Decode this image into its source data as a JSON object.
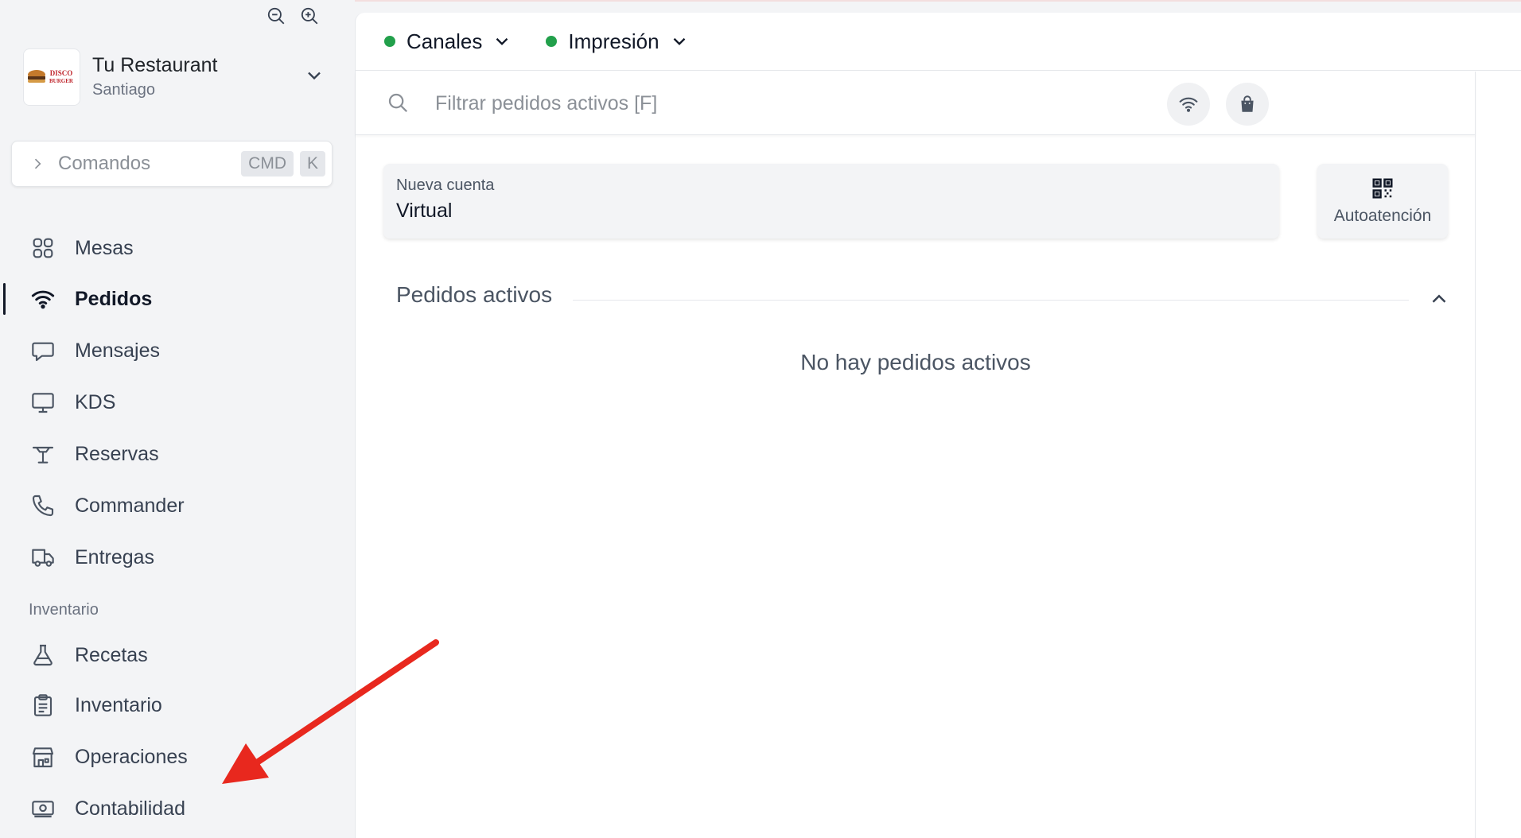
{
  "sidebar": {
    "restaurant": {
      "name": "Tu Restaurant",
      "city": "Santiago",
      "logo_text_top": "DISCO",
      "logo_text_bottom": "BURGER"
    },
    "commands": {
      "label": "Comandos",
      "key1": "CMD",
      "key2": "K"
    },
    "nav": [
      {
        "label": "Mesas",
        "icon": "grid-icon"
      },
      {
        "label": "Pedidos",
        "icon": "wifi-icon",
        "active": true
      },
      {
        "label": "Mensajes",
        "icon": "chat-bubble-icon"
      },
      {
        "label": "KDS",
        "icon": "monitor-icon"
      },
      {
        "label": "Reservas",
        "icon": "table-icon"
      },
      {
        "label": "Commander",
        "icon": "phone-icon"
      },
      {
        "label": "Entregas",
        "icon": "truck-icon"
      }
    ],
    "section_inventario": "Inventario",
    "nav2": [
      {
        "label": "Recetas",
        "icon": "flask-icon"
      },
      {
        "label": "Inventario",
        "icon": "clipboard-icon"
      },
      {
        "label": "Operaciones",
        "icon": "store-icon"
      },
      {
        "label": "Contabilidad",
        "icon": "cash-icon"
      }
    ]
  },
  "topbar": {
    "channels": {
      "label": "Canales",
      "status_color": "#22a04b"
    },
    "printing": {
      "label": "Impresión",
      "status_color": "#22a04b"
    }
  },
  "search": {
    "placeholder": "Filtrar pedidos activos [F]"
  },
  "new_account": {
    "title": "Nueva cuenta",
    "value": "Virtual"
  },
  "self_service": {
    "label": "Autoatención"
  },
  "active_orders": {
    "title": "Pedidos activos",
    "empty": "No hay pedidos activos"
  },
  "colors": {
    "annotation_arrow": "#e8281e",
    "accent_green": "#22a04b"
  }
}
